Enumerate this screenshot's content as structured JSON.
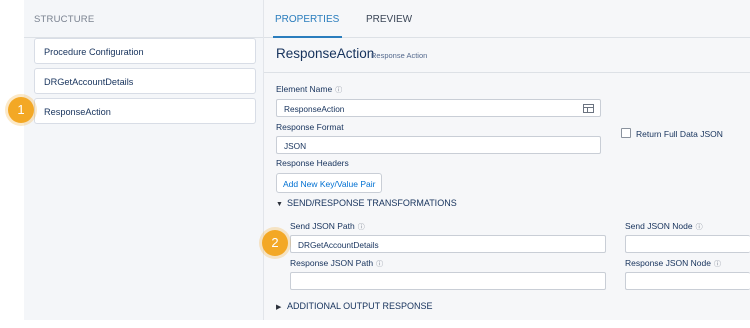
{
  "structure": {
    "header": "STRUCTURE",
    "items": [
      {
        "label": "Procedure Configuration"
      },
      {
        "label": "DRGetAccountDetails"
      },
      {
        "label": "ResponseAction"
      }
    ]
  },
  "badges": {
    "one": "1",
    "two": "2"
  },
  "tabs": {
    "properties": "PROPERTIES",
    "preview": "PREVIEW"
  },
  "element": {
    "title": "ResponseAction",
    "subtitle": "Response Action"
  },
  "form": {
    "element_name_label": "Element Name",
    "element_name_value": "ResponseAction",
    "response_format_label": "Response Format",
    "response_format_value": "JSON",
    "return_full_label": "Return Full Data JSON",
    "response_headers_label": "Response Headers",
    "add_pair_button": "Add New Key/Value Pair"
  },
  "send_section": {
    "title": "SEND/RESPONSE TRANSFORMATIONS",
    "send_json_path_label": "Send JSON Path",
    "send_json_path_value": "DRGetAccountDetails",
    "send_json_node_label": "Send JSON Node",
    "response_json_path_label": "Response JSON Path",
    "response_json_node_label": "Response JSON Node"
  },
  "additional_section": {
    "title": "ADDITIONAL OUTPUT RESPONSE"
  },
  "colors": {
    "accent": "#2a7dbd",
    "badge": "#f3a825",
    "link": "#0070d2"
  },
  "icons": {
    "info": "info-icon",
    "table": "table-icon",
    "caret": "caret-icon"
  }
}
